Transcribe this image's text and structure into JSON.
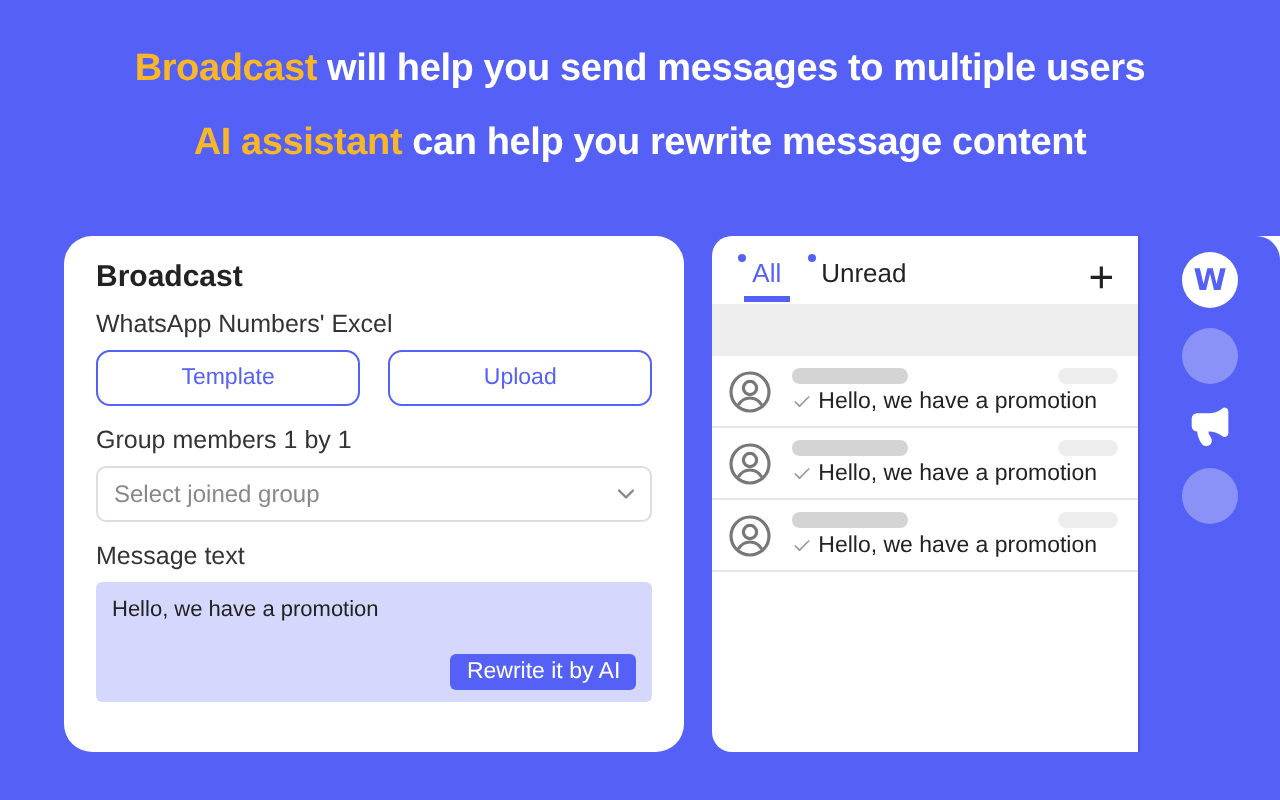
{
  "headlines": [
    {
      "highlight": "Broadcast",
      "text": " will help you send messages to multiple users"
    },
    {
      "highlight": "AI assistant",
      "text": " can help you rewrite message content"
    }
  ],
  "broadcast": {
    "title": "Broadcast",
    "excel_label": "WhatsApp Numbers' Excel",
    "buttons": [
      "Template",
      "Upload"
    ],
    "group_label": "Group members 1 by 1",
    "group_select": {
      "placeholder": "Select joined group"
    },
    "message_label": "Message  text",
    "message": {
      "value": "Hello, we have a promotion"
    },
    "rewrite_button": "Rewrite it by AI"
  },
  "chat_panel": {
    "tabs": [
      {
        "label": "All",
        "selected": true
      },
      {
        "label": "Unread",
        "selected": false
      }
    ],
    "add_button": "+",
    "chats": [
      {
        "preview": "Hello, we have a promotion"
      },
      {
        "preview": "Hello, we have a promotion"
      },
      {
        "preview": "Hello, we have a promotion"
      }
    ]
  },
  "sidebar": {
    "logo": "W",
    "items": [
      {
        "kind": "circle"
      },
      {
        "kind": "megaphone"
      },
      {
        "kind": "circle"
      }
    ]
  }
}
